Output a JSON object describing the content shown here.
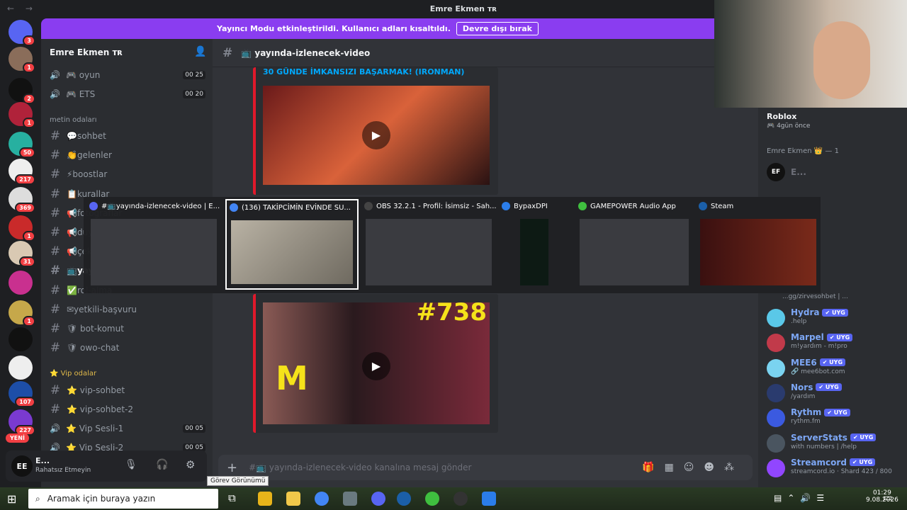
{
  "window": {
    "nav": "← →",
    "title": "Emre Ekmen ᴛʀ"
  },
  "banner": {
    "text": "Yayıncı Modu etkinleştirildi. Kullanıcı adları kısaltıldı.",
    "button": "Devre dışı bırak"
  },
  "servers": [
    {
      "badge": "3",
      "color": "#5865f2"
    },
    {
      "badge": "1",
      "color": "#8a6d5a"
    },
    {
      "badge": "2",
      "color": "#111111"
    },
    {
      "badge": "1",
      "color": "#b0223a"
    },
    {
      "badge": "50",
      "color": "#27b0a0"
    },
    {
      "badge": "217",
      "color": "#eeeeee"
    },
    {
      "badge": "369",
      "color": "#dddddd"
    },
    {
      "badge": "1",
      "color": "#c92a2a"
    },
    {
      "badge": "31",
      "color": "#d9c9b3"
    },
    {
      "badge": "",
      "color": "#c9308f"
    },
    {
      "badge": "1",
      "color": "#c6a84a"
    },
    {
      "badge": "",
      "color": "#111111"
    },
    {
      "badge": "",
      "color": "#eeeeee"
    },
    {
      "badge": "107",
      "color": "#1d4ea8"
    },
    {
      "badge": "227",
      "color": "#7a3ad0"
    }
  ],
  "new_label": "YENİ",
  "server_header": "Emre Ekmen ᴛʀ",
  "channels": {
    "voice_top": [
      {
        "name": "🎮 oyun",
        "count": "00 25"
      },
      {
        "name": "🎮 ETS",
        "count": "00 20"
      }
    ],
    "cat_text": "metin odaları",
    "text": [
      "💬sohbet",
      "👏gelenler",
      "⚡boostlar",
      "📋kurallar",
      "📢fotoğraflar",
      "📢duyurular",
      "📢çekiliş",
      "📺yayında-izlenecek-video",
      "✅rol-alma",
      "✉yetkili-başvuru",
      "🛡 bot-komut",
      "🛡 owo-chat"
    ],
    "cat_vip": "⭐ Vip odalar",
    "vip": [
      "⭐ vip-sohbet",
      "⭐ vip-sohbet-2"
    ],
    "vip_voice": [
      {
        "name": "⭐ Vip Sesli-1",
        "count": "00 05"
      },
      {
        "name": "⭐ Vip Sesli-2",
        "count": "00 05"
      }
    ]
  },
  "user": {
    "name": "E...",
    "status": "Rahatsız Etmeyin"
  },
  "chat": {
    "channel": "📺 yayında-izlenecek-video",
    "embed1_title": "30 GÜNDE İMKANSIZI BAŞARMAK! (IRONMAN)",
    "embed2_num": "#738",
    "placeholder": "#📺 yayında-izlenecek-video kanalına mesaj gönder"
  },
  "members": {
    "activity_title": "Roblox",
    "activity_sub": "🎮 4gün önce",
    "group": "Emre Ekmen 👑 — 1",
    "owner": "E...",
    "bot_partial": "...gg/zirvesohbet | ...",
    "list": [
      {
        "name": "Hydra",
        "sub": ".help",
        "color": "#5ac8e8"
      },
      {
        "name": "Marpel",
        "sub": "m!yardım - m!pro",
        "color": "#c13a4a"
      },
      {
        "name": "MEE6",
        "sub": "🔗 mee6bot.com",
        "color": "#7ad3f0"
      },
      {
        "name": "Nors",
        "sub": "/yardım",
        "color": "#2a3b6e"
      },
      {
        "name": "Rythm",
        "sub": "rythm.fm",
        "color": "#3b5ae0"
      },
      {
        "name": "ServerStats",
        "sub": "with numbers | /help",
        "color": "#4a5560"
      },
      {
        "name": "Streamcord",
        "sub": "streamcord.io · Shard 423 / 800",
        "color": "#9146ff"
      }
    ],
    "tag": "UYG"
  },
  "switcher": [
    {
      "label": "#📺yayında-izlenecek-video | E...",
      "icon": "#5865f2"
    },
    {
      "label": "(136) TAKİPCİMİN EVİNDE SU...",
      "icon": "#4285f4"
    },
    {
      "label": "OBS 32.2.1 - Profil: İsimsiz - Sah...",
      "icon": "#444444"
    },
    {
      "label": "BypaxDPI",
      "icon": "#2b7de9"
    },
    {
      "label": "GAMEPOWER Audio App",
      "icon": "#3fbf3f"
    },
    {
      "label": "Steam",
      "icon": "#1b5fa8"
    }
  ],
  "taskbar": {
    "search": "Aramak için buraya yazın",
    "tooltip": "Görev Görünümü",
    "time": "01:29",
    "date": "9.08.2026"
  }
}
